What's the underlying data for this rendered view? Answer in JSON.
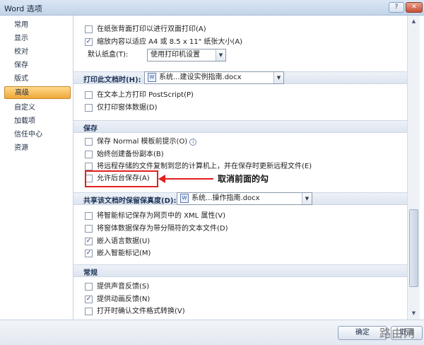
{
  "window": {
    "title": "Word 选项",
    "help_glyph": "?",
    "close_glyph": "✕"
  },
  "nav": {
    "items": [
      {
        "label": "常用"
      },
      {
        "label": "显示"
      },
      {
        "label": "校对"
      },
      {
        "label": "保存"
      },
      {
        "label": "版式"
      },
      {
        "label": "高级"
      },
      {
        "label": "自定义"
      },
      {
        "label": "加载项"
      },
      {
        "label": "信任中心"
      },
      {
        "label": "资源"
      }
    ],
    "active_index": 5
  },
  "print": {
    "rows": [
      {
        "label": "在纸张背面打印以进行双面打印(A)",
        "checked": false
      },
      {
        "label": "缩放内容以适应 A4 或 8.5 x 11\" 纸张大小(A)",
        "checked": true
      }
    ],
    "paper_tray_label": "默认纸盒(T):",
    "paper_tray_value": "使用打印机设置"
  },
  "print_doc": {
    "section_label": "打印此文档时(H):",
    "doc_value": "系统...建设实例指南.docx",
    "rows": [
      {
        "label": "在文本上方打印 PostScript(P)",
        "checked": false
      },
      {
        "label": "仅打印窗体数据(D)",
        "checked": false
      }
    ]
  },
  "save": {
    "section_label": "保存",
    "rows": [
      {
        "label": "保存 Normal 模板前提示(O)",
        "checked": false,
        "info": true
      },
      {
        "label": "始终创建备份副本(B)",
        "checked": false
      },
      {
        "label": "将远程存储的文件复制到您的计算机上，并在保存时更新远程文件(E)",
        "checked": false
      },
      {
        "label": "允许后台保存(A)",
        "checked": false
      }
    ]
  },
  "share": {
    "section_label": "共享该文档时保留保真度(D):",
    "doc_value": "系统...操作指南.docx",
    "rows": [
      {
        "label": "将智能标记保存为网页中的 XML 属性(V)",
        "checked": false
      },
      {
        "label": "将窗体数据保存为带分隔符的文本文件(D)",
        "checked": false
      },
      {
        "label": "嵌入语言数据(U)",
        "checked": true
      },
      {
        "label": "嵌入智能标记(M)",
        "checked": true
      }
    ]
  },
  "general": {
    "section_label": "常规",
    "rows": [
      {
        "label": "提供声音反馈(S)",
        "checked": false
      },
      {
        "label": "提供动画反馈(N)",
        "checked": true
      },
      {
        "label": "打开时确认文件格式转换(V)",
        "checked": false
      }
    ]
  },
  "annotation": {
    "text": "取消前面的勾"
  },
  "buttons": {
    "ok": "确定",
    "cancel": "取消"
  },
  "watermark": "路由网",
  "icons": {
    "doc": "word-document-icon",
    "info": "info-icon",
    "dropdown": "chevron-down-icon",
    "check_glyph": "✓"
  },
  "colors": {
    "accent": "#f0a83a",
    "annotation": "#e02020",
    "section_bg": "#dde5f0"
  }
}
